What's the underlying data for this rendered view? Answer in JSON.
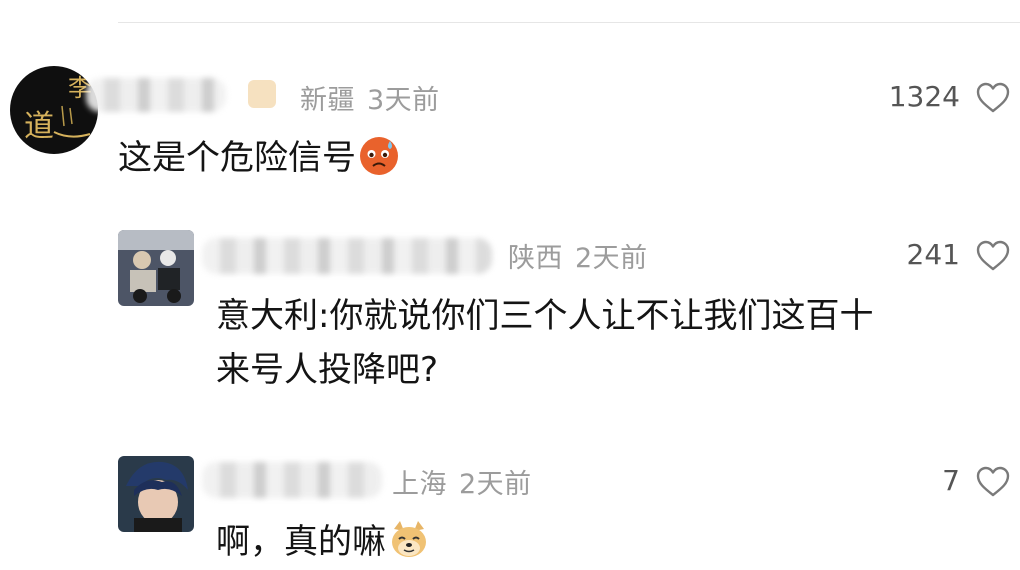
{
  "comments": [
    {
      "location": "新疆",
      "time": "3天前",
      "likes": "1324",
      "text": "这是个危险信号",
      "emoji": "worried-face-emoji",
      "avatar_text": "李 道"
    },
    {
      "location": "陕西",
      "time": "2天前",
      "likes": "241",
      "text_line1": "意大利:你就说你们三个人让不让我们这百十",
      "text_line2": "来号人投降吧?"
    },
    {
      "location": "上海",
      "time": "2天前",
      "likes": "7",
      "text": "啊，真的嘛",
      "emoji": "doge-emoji"
    }
  ],
  "colors": {
    "meta": "#9c9c9c",
    "text": "#141414",
    "heart_stroke": "#7a7a7a",
    "divider": "#e6e6e6"
  }
}
